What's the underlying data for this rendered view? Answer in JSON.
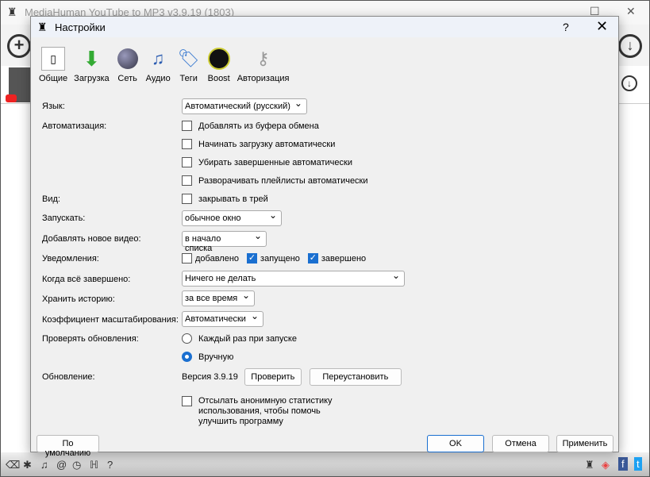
{
  "main": {
    "title": "MediaHuman YouTube to MP3 v3.9.19 (1803)"
  },
  "dialog": {
    "title": "Настройки",
    "help": "?",
    "close": "✕",
    "tabs": [
      {
        "label": "Общие",
        "icon": "switch-icon"
      },
      {
        "label": "Загрузка",
        "icon": "download-arrow-icon"
      },
      {
        "label": "Сеть",
        "icon": "globe-icon"
      },
      {
        "label": "Аудио",
        "icon": "music-note-icon"
      },
      {
        "label": "Теги",
        "icon": "tag-icon"
      },
      {
        "label": "Boost",
        "icon": "gauge-icon"
      },
      {
        "label": "Авторизация",
        "icon": "keys-icon"
      }
    ],
    "language": {
      "label": "Язык:",
      "value": "Автоматический (русский)"
    },
    "automation": {
      "label": "Автоматизация:",
      "options": [
        {
          "label": "Добавлять из буфера обмена",
          "checked": false
        },
        {
          "label": "Начинать загрузку автоматически",
          "checked": false
        },
        {
          "label": "Убирать завершенные автоматически",
          "checked": false
        },
        {
          "label": "Разворачивать плейлисты автоматически",
          "checked": false
        }
      ]
    },
    "view": {
      "label": "Вид:",
      "option": "закрывать в трей",
      "checked": false
    },
    "launch": {
      "label": "Запускать:",
      "value": "обычное окно"
    },
    "add_video": {
      "label": "Добавлять новое видео:",
      "value": "в начало списка"
    },
    "notifications": {
      "label": "Уведомления:",
      "options": [
        {
          "label": "добавлено",
          "checked": false
        },
        {
          "label": "запущено",
          "checked": true
        },
        {
          "label": "завершено",
          "checked": true
        }
      ]
    },
    "when_done": {
      "label": "Когда всё завершено:",
      "value": "Ничего не делать"
    },
    "history": {
      "label": "Хранить историю:",
      "value": "за все время"
    },
    "scale": {
      "label": "Коэффициент масштабирования:",
      "value": "Автоматически"
    },
    "updates": {
      "label": "Проверять обновления:",
      "options": [
        {
          "label": "Каждый раз при запуске",
          "selected": false
        },
        {
          "label": "Вручную",
          "selected": true
        }
      ]
    },
    "update": {
      "label": "Обновление:",
      "version": "Версия 3.9.19",
      "check": "Проверить",
      "reinstall": "Переустановить"
    },
    "stats": {
      "label": "Отсылать анонимную статистику использования, чтобы помочь улучшить программу",
      "checked": false
    },
    "buttons": {
      "defaults": "По умолчанию",
      "ok": "OK",
      "cancel": "Отмена",
      "apply": "Применить"
    }
  },
  "accent": "#1a6fd0"
}
